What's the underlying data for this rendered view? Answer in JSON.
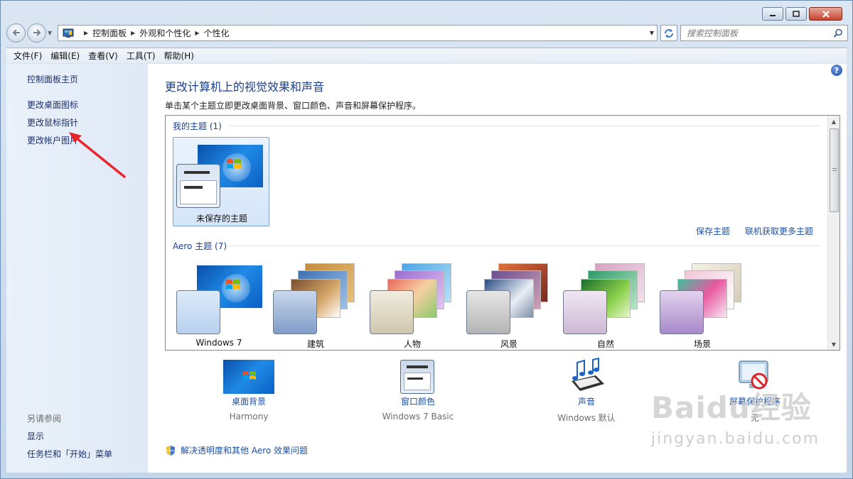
{
  "window": {
    "caption_buttons": [
      "minimize",
      "maximize",
      "close"
    ]
  },
  "nav": {
    "breadcrumbs": [
      "控制面板",
      "外观和个性化",
      "个性化"
    ],
    "search_placeholder": "搜索控制面板"
  },
  "menu": [
    "文件(F)",
    "编辑(E)",
    "查看(V)",
    "工具(T)",
    "帮助(H)"
  ],
  "left": {
    "links": [
      "控制面板主页",
      "更改桌面图标",
      "更改鼠标指针",
      "更改帐户图片"
    ],
    "see_also_title": "另请参阅",
    "see_also": [
      "显示",
      "任务栏和「开始」菜单"
    ]
  },
  "main": {
    "title": "更改计算机上的视觉效果和声音",
    "description": "单击某个主题立即更改桌面背景、窗口颜色、声音和屏幕保护程序。",
    "my_themes_label": "我的主题 (1)",
    "unsaved_theme": "未保存的主题",
    "save_theme": "保存主题",
    "get_more_themes": "联机获取更多主题",
    "aero_label": "Aero 主题 (7)",
    "aero_themes": [
      "Windows 7",
      "建筑",
      "人物",
      "风景",
      "自然",
      "场景"
    ],
    "bottom": [
      {
        "link": "桌面背景",
        "sub": "Harmony"
      },
      {
        "link": "窗口颜色",
        "sub": "Windows 7 Basic"
      },
      {
        "link": "声音",
        "sub": "Windows 默认"
      },
      {
        "link": "屏幕保护程序",
        "sub": "无"
      }
    ],
    "troubleshoot": "解决透明度和其他 Aero 效果问题"
  },
  "watermark": {
    "brand": "Baidu经验",
    "url": "jingyan.baidu.com"
  },
  "colors": {
    "link": "#1d4fa3",
    "title": "#1d3f8a",
    "annotation_arrow": "#e8262b"
  }
}
